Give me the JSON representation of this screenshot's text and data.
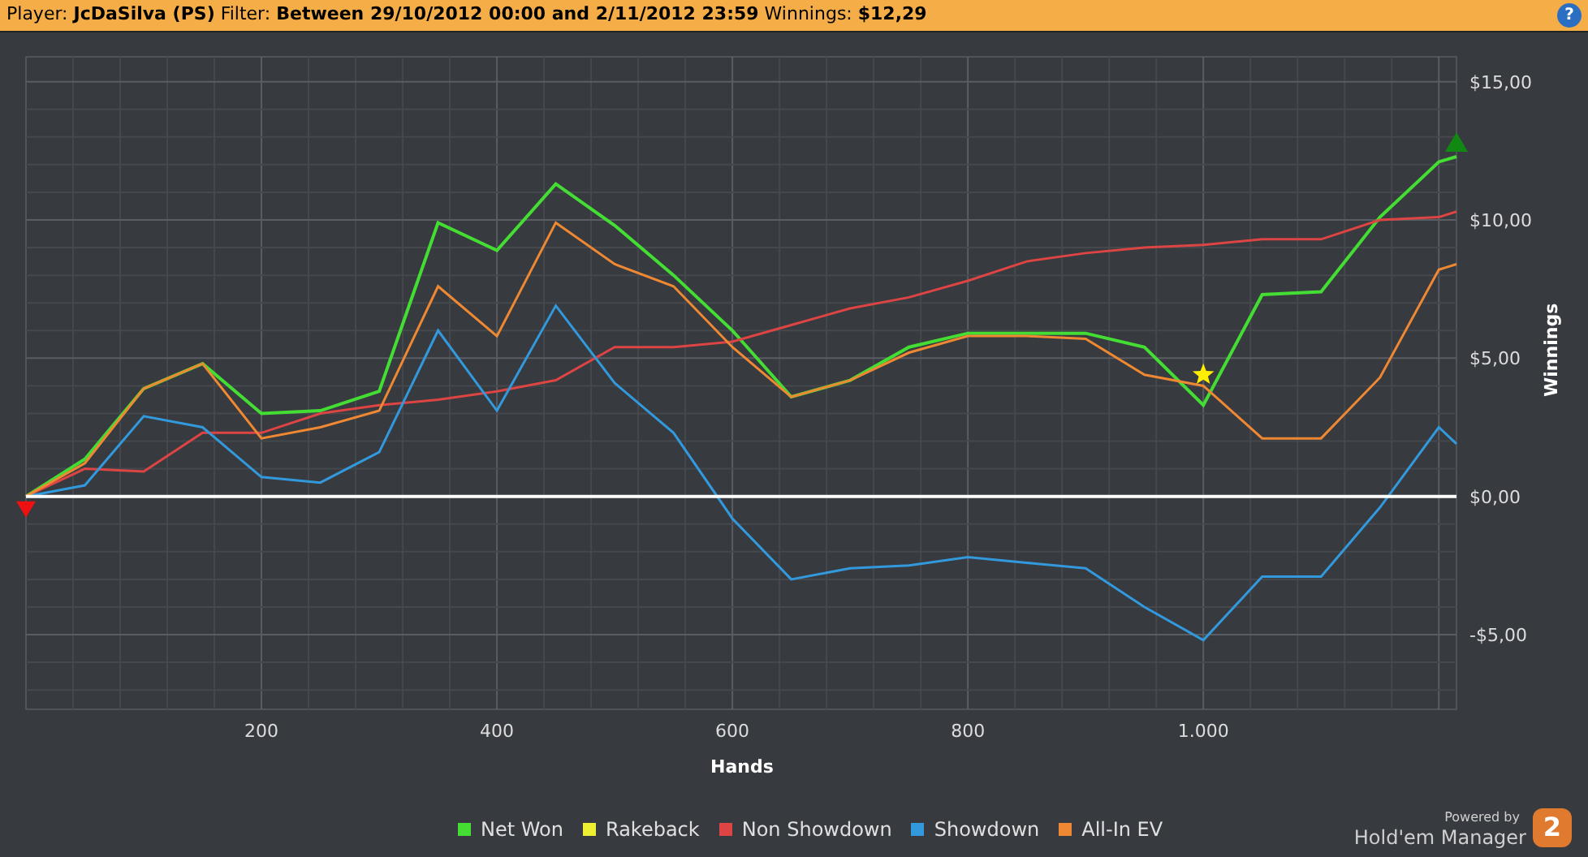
{
  "header": {
    "text": "Player: **JcDaSilva (PS)** Filter: **Between 29/10/2012 00:00 and 2/11/2012 23:59** Winnings: **$12,29**",
    "help_button": "?"
  },
  "chart": {
    "chart_data": {
      "type": "line",
      "xlabel": "Hands",
      "ylabel": "Winnings",
      "grid": true,
      "xlim": [
        0,
        1215
      ],
      "ylim": [
        -7.7,
        15.9
      ],
      "xticks": [
        200,
        400,
        600,
        800,
        {
          "value": 1000,
          "label": "1.000"
        }
      ],
      "yticks": [
        {
          "value": -5,
          "label": "-$5,00"
        },
        {
          "value": 0,
          "label": "$0,00"
        },
        {
          "value": 5,
          "label": "$5,00"
        },
        {
          "value": 10,
          "label": "$10,00"
        },
        {
          "value": 15,
          "label": "$15,00"
        }
      ],
      "x": [
        0,
        50,
        100,
        150,
        200,
        250,
        300,
        350,
        400,
        450,
        500,
        550,
        600,
        650,
        700,
        750,
        800,
        850,
        900,
        950,
        1000,
        1050,
        1100,
        1150,
        1200,
        1215
      ],
      "series": [
        {
          "name": "Net Won",
          "color": "#44dd33",
          "values": [
            0,
            1.35,
            3.9,
            4.8,
            3.0,
            3.1,
            3.8,
            9.9,
            8.9,
            11.3,
            9.8,
            8.0,
            6.0,
            3.6,
            4.2,
            5.4,
            5.9,
            5.9,
            5.9,
            5.4,
            3.3,
            7.3,
            7.4,
            10.1,
            12.1,
            12.29
          ]
        },
        {
          "name": "Rakeback",
          "color": "#eeee33",
          "values": [
            null,
            null,
            null,
            null,
            null,
            null,
            null,
            null,
            null,
            null,
            null,
            null,
            null,
            null,
            null,
            null,
            null,
            null,
            null,
            null,
            null,
            null,
            null,
            null,
            null,
            null
          ]
        },
        {
          "name": "Non Showdown",
          "color": "#dd4444",
          "values": [
            0,
            1.0,
            0.9,
            2.3,
            2.3,
            3.0,
            3.3,
            3.5,
            3.8,
            4.2,
            5.4,
            5.4,
            5.6,
            6.2,
            6.8,
            7.2,
            7.8,
            8.5,
            8.8,
            9.0,
            9.1,
            9.3,
            9.3,
            10.0,
            10.1,
            10.3
          ]
        },
        {
          "name": "Showdown",
          "color": "#3399dd",
          "values": [
            0,
            0.4,
            2.9,
            2.5,
            0.7,
            0.5,
            1.6,
            6.0,
            3.1,
            6.9,
            4.1,
            2.3,
            -0.8,
            -3.0,
            -2.6,
            -2.5,
            -2.2,
            -2.4,
            -2.6,
            -4.0,
            -5.2,
            -2.9,
            -2.9,
            -0.4,
            2.5,
            1.9
          ]
        },
        {
          "name": "All-In EV",
          "color": "#ee8833",
          "values": [
            0,
            1.2,
            3.9,
            4.8,
            2.1,
            2.5,
            3.1,
            7.6,
            5.8,
            9.9,
            8.4,
            7.6,
            5.4,
            3.6,
            4.2,
            5.2,
            5.8,
            5.8,
            5.7,
            4.4,
            4.0,
            2.1,
            2.1,
            4.3,
            8.2,
            8.4
          ]
        }
      ]
    }
  },
  "branding": {
    "powered_by": "Powered by",
    "product": "Hold'em Manager",
    "logo_text": "2"
  }
}
